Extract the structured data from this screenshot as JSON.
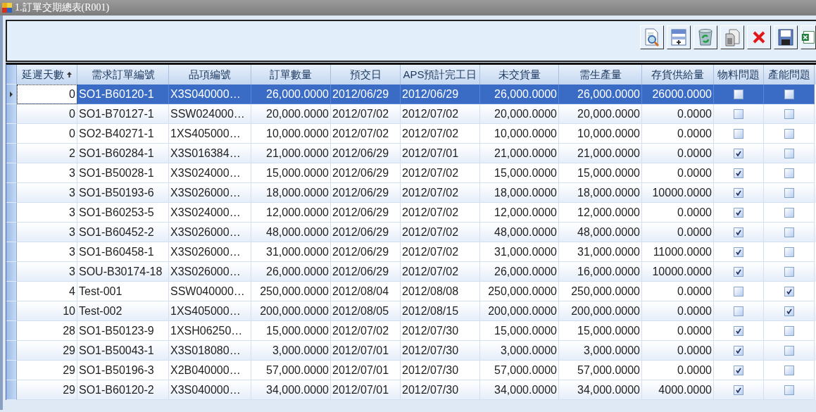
{
  "window": {
    "title": "1.訂單交期總表(R001)"
  },
  "columns": [
    {
      "label": "延遲天數",
      "sorted": true
    },
    {
      "label": "需求訂單編號",
      "sorted": false
    },
    {
      "label": "品項編號",
      "sorted": false
    },
    {
      "label": "訂單數量",
      "sorted": false
    },
    {
      "label": "預交日",
      "sorted": false
    },
    {
      "label": "APS預計完工日",
      "sorted": false
    },
    {
      "label": "未交貨量",
      "sorted": false
    },
    {
      "label": "需生產量",
      "sorted": false
    },
    {
      "label": "存貨供給量",
      "sorted": false
    },
    {
      "label": "物料問題",
      "sorted": false
    },
    {
      "label": "產能問題",
      "sorted": false
    }
  ],
  "rows": [
    {
      "selected": true,
      "cells": [
        "0",
        "SO1-B60120-1",
        "X3S040000…",
        "26,000.0000",
        "2012/06/29",
        "2012/06/29",
        "26,000.0000",
        "26,000.0000",
        "26000.0000"
      ],
      "material_issue": false,
      "capacity_issue": false
    },
    {
      "selected": false,
      "cells": [
        "0",
        "SO1-B70127-1",
        "SSW024000…",
        "20,000.0000",
        "2012/07/02",
        "2012/07/02",
        "20,000.0000",
        "20,000.0000",
        "0.0000"
      ],
      "material_issue": false,
      "capacity_issue": false
    },
    {
      "selected": false,
      "cells": [
        "0",
        "SO2-B40271-1",
        "1XS405000…",
        "10,000.0000",
        "2012/07/02",
        "2012/07/02",
        "10,000.0000",
        "10,000.0000",
        "0.0000"
      ],
      "material_issue": false,
      "capacity_issue": false
    },
    {
      "selected": false,
      "cells": [
        "2",
        "SO1-B60284-1",
        "X3S016384…",
        "21,000.0000",
        "2012/06/29",
        "2012/07/01",
        "21,000.0000",
        "21,000.0000",
        "0.0000"
      ],
      "material_issue": true,
      "capacity_issue": false
    },
    {
      "selected": false,
      "cells": [
        "3",
        "SO1-B50028-1",
        "X3S024000…",
        "15,000.0000",
        "2012/06/29",
        "2012/07/02",
        "15,000.0000",
        "15,000.0000",
        "0.0000"
      ],
      "material_issue": true,
      "capacity_issue": false
    },
    {
      "selected": false,
      "cells": [
        "3",
        "SO1-B50193-6",
        "X3S026000…",
        "18,000.0000",
        "2012/06/29",
        "2012/07/02",
        "18,000.0000",
        "18,000.0000",
        "10000.0000"
      ],
      "material_issue": true,
      "capacity_issue": false
    },
    {
      "selected": false,
      "cells": [
        "3",
        "SO1-B60253-5",
        "X3S024000…",
        "12,000.0000",
        "2012/06/29",
        "2012/07/02",
        "12,000.0000",
        "12,000.0000",
        "0.0000"
      ],
      "material_issue": true,
      "capacity_issue": false
    },
    {
      "selected": false,
      "cells": [
        "3",
        "SO1-B60452-2",
        "X3S026000…",
        "48,000.0000",
        "2012/06/29",
        "2012/07/02",
        "48,000.0000",
        "48,000.0000",
        "0.0000"
      ],
      "material_issue": true,
      "capacity_issue": false
    },
    {
      "selected": false,
      "cells": [
        "3",
        "SO1-B60458-1",
        "X3S026000…",
        "31,000.0000",
        "2012/06/29",
        "2012/07/02",
        "31,000.0000",
        "31,000.0000",
        "11000.0000"
      ],
      "material_issue": true,
      "capacity_issue": false
    },
    {
      "selected": false,
      "cells": [
        "3",
        "SOU-B30174-18",
        "X3S026000…",
        "26,000.0000",
        "2012/06/29",
        "2012/07/02",
        "26,000.0000",
        "16,000.0000",
        "10000.0000"
      ],
      "material_issue": true,
      "capacity_issue": false
    },
    {
      "selected": false,
      "cells": [
        "4",
        "Test-001",
        "SSW040000…",
        "250,000.0000",
        "2012/08/04",
        "2012/08/08",
        "250,000.0000",
        "250,000.0000",
        "0.0000"
      ],
      "material_issue": false,
      "capacity_issue": true
    },
    {
      "selected": false,
      "cells": [
        "10",
        "Test-002",
        "1XS405000…",
        "200,000.0000",
        "2012/08/05",
        "2012/08/15",
        "200,000.0000",
        "200,000.0000",
        "0.0000"
      ],
      "material_issue": false,
      "capacity_issue": true
    },
    {
      "selected": false,
      "cells": [
        "28",
        "SO1-B50123-9",
        "1XSH06250…",
        "15,000.0000",
        "2012/07/02",
        "2012/07/30",
        "15,000.0000",
        "15,000.0000",
        "0.0000"
      ],
      "material_issue": true,
      "capacity_issue": false
    },
    {
      "selected": false,
      "cells": [
        "29",
        "SO1-B50043-1",
        "X3S018080…",
        "3,000.0000",
        "2012/07/01",
        "2012/07/30",
        "3,000.0000",
        "3,000.0000",
        "0.0000"
      ],
      "material_issue": true,
      "capacity_issue": false
    },
    {
      "selected": false,
      "cells": [
        "29",
        "SO1-B50196-3",
        "X2B040000…",
        "57,000.0000",
        "2012/07/01",
        "2012/07/30",
        "57,000.0000",
        "57,000.0000",
        "0.0000"
      ],
      "material_issue": true,
      "capacity_issue": false
    },
    {
      "selected": false,
      "cells": [
        "29",
        "SO1-B60120-2",
        "X3S040000…",
        "34,000.0000",
        "2012/07/01",
        "2012/07/30",
        "34,000.0000",
        "34,000.0000",
        "4000.0000"
      ],
      "material_issue": true,
      "capacity_issue": false
    }
  ]
}
